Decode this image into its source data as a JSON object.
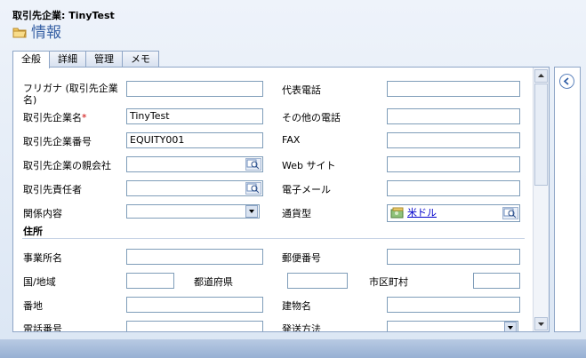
{
  "header": {
    "entity": "取引先企業: TinyTest",
    "section": "情報"
  },
  "tabs": [
    "全般",
    "詳細",
    "管理",
    "メモ"
  ],
  "form": {
    "furigana": {
      "label": "フリガナ (取引先企業名)",
      "value": ""
    },
    "account_name": {
      "label": "取引先企業名",
      "required": "*",
      "value": "TinyTest"
    },
    "account_number": {
      "label": "取引先企業番号",
      "value": "EQUITY001"
    },
    "parent_account": {
      "label": "取引先企業の親会社",
      "value": ""
    },
    "primary_contact": {
      "label": "取引先責任者",
      "value": ""
    },
    "relationship": {
      "label": "関係内容",
      "value": ""
    },
    "main_phone": {
      "label": "代表電話",
      "value": ""
    },
    "other_phone": {
      "label": "その他の電話",
      "value": ""
    },
    "fax": {
      "label": "FAX",
      "value": ""
    },
    "website": {
      "label": "Web サイト",
      "value": ""
    },
    "email": {
      "label": "電子メール",
      "value": ""
    },
    "currency": {
      "label": "通貨型",
      "value": "米ドル"
    }
  },
  "address": {
    "title": "住所",
    "office_name": {
      "label": "事業所名",
      "value": ""
    },
    "postal_code": {
      "label": "郵便番号",
      "value": ""
    },
    "country": {
      "label": "国/地域",
      "value": ""
    },
    "prefecture": {
      "label": "都道府県",
      "value": ""
    },
    "city": {
      "label": "市区町村",
      "value": ""
    },
    "street": {
      "label": "番地",
      "value": ""
    },
    "building": {
      "label": "建物名",
      "value": ""
    },
    "phone": {
      "label": "電話番号",
      "value": ""
    },
    "shipping_method": {
      "label": "発送方法",
      "value": ""
    }
  },
  "colors": {
    "accent": "#3a63a6",
    "border": "#8ea5c6",
    "required": "#cc0000"
  }
}
